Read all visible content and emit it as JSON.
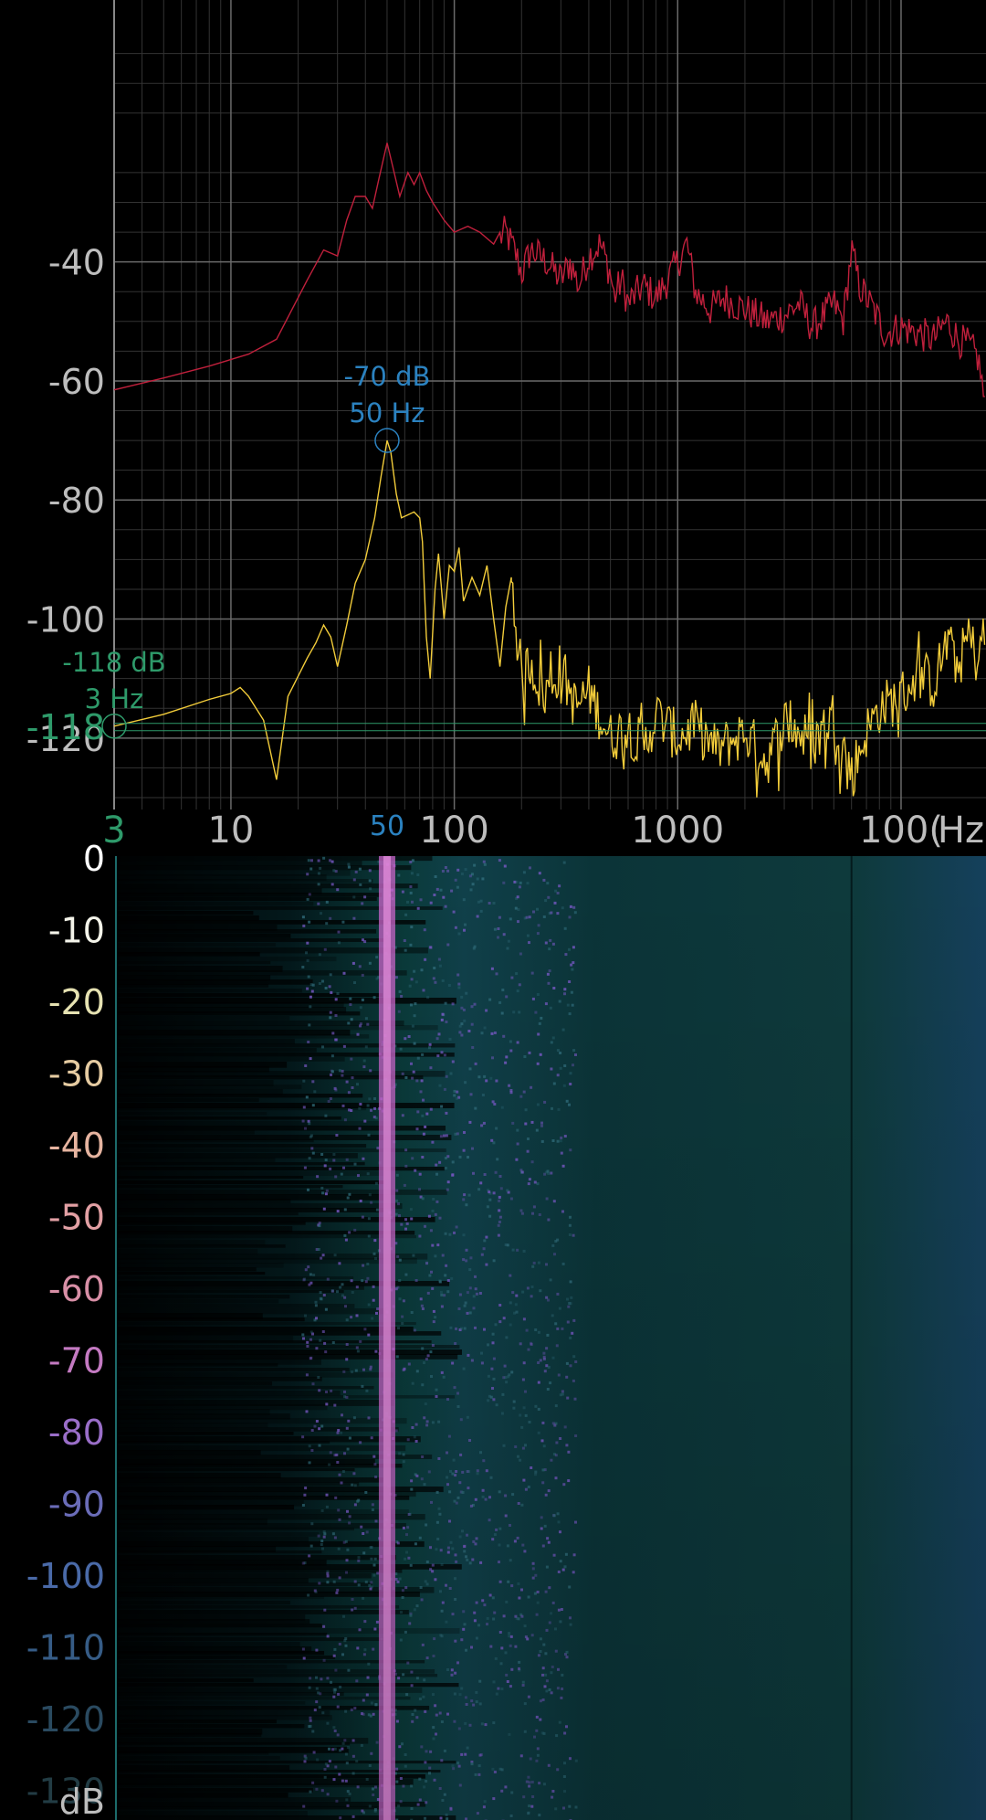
{
  "app": {
    "colors": {
      "background": "#000000",
      "grid_major": "#6a6a6a",
      "grid_minor": "#333333",
      "peak_hold_line": "#c0203c",
      "live_spectrum_line": "#f2cc3a",
      "peak_marker": "#2b82c0",
      "cursor_marker": "#2e9a6a",
      "axis_text": "#bdbdbd",
      "spectrogram_base": "#062a2e",
      "spectrogram_hot": "#cc66cc"
    }
  },
  "chart_data": [
    {
      "type": "line",
      "x_scale": "log",
      "xlim": [
        3,
        24000
      ],
      "ylim": [
        -132,
        4
      ],
      "grid": true,
      "x_unit": "Hz",
      "y_ticks": [
        -40,
        -60,
        -80,
        -100,
        -120
      ],
      "x_ticks": [
        10,
        100,
        1000,
        10000
      ],
      "x_tick_labels": [
        "10",
        "100",
        "1000",
        "100("
      ],
      "series": [
        {
          "color": "#c0203c",
          "points": [
            [
              3,
              -61.5
            ],
            [
              5,
              -59.5
            ],
            [
              8,
              -57.5
            ],
            [
              12,
              -55.5
            ],
            [
              16,
              -53
            ],
            [
              22,
              -43
            ],
            [
              26,
              -38
            ],
            [
              30,
              -39
            ],
            [
              33,
              -33
            ],
            [
              36,
              -29
            ],
            [
              40,
              -29
            ],
            [
              43,
              -31
            ],
            [
              46,
              -26
            ],
            [
              50,
              -20
            ],
            [
              53,
              -24
            ],
            [
              57,
              -29
            ],
            [
              62,
              -25
            ],
            [
              66,
              -27
            ],
            [
              70,
              -25
            ],
            [
              75,
              -28
            ],
            [
              80,
              -30
            ],
            [
              90,
              -33
            ],
            [
              100,
              -35
            ],
            [
              115,
              -34
            ],
            [
              130,
              -35
            ],
            [
              150,
              -37
            ],
            [
              170,
              -35
            ],
            [
              190,
              -39
            ],
            [
              200,
              -42
            ],
            [
              220,
              -38
            ],
            [
              260,
              -40
            ],
            [
              300,
              -43
            ],
            [
              330,
              -40
            ],
            [
              360,
              -44
            ],
            [
              400,
              -39
            ],
            [
              450,
              -37
            ],
            [
              500,
              -42
            ],
            [
              520,
              -46
            ],
            [
              560,
              -43
            ],
            [
              600,
              -47
            ],
            [
              700,
              -44
            ],
            [
              800,
              -46
            ],
            [
              900,
              -43
            ],
            [
              1000,
              -40
            ],
            [
              1100,
              -37
            ],
            [
              1200,
              -45
            ],
            [
              1400,
              -48
            ],
            [
              1600,
              -46
            ],
            [
              2000,
              -48
            ],
            [
              2500,
              -50
            ],
            [
              3000,
              -49
            ],
            [
              3500,
              -47
            ],
            [
              4000,
              -51
            ],
            [
              4500,
              -49
            ],
            [
              5000,
              -47
            ],
            [
              5500,
              -50
            ],
            [
              6000,
              -38
            ],
            [
              6500,
              -44
            ],
            [
              7500,
              -48
            ],
            [
              8500,
              -52
            ],
            [
              10000,
              -51
            ],
            [
              12000,
              -52
            ],
            [
              14000,
              -53
            ],
            [
              16000,
              -50
            ],
            [
              18000,
              -53
            ],
            [
              20000,
              -54
            ],
            [
              22000,
              -56
            ],
            [
              23000,
              -60
            ],
            [
              24000,
              -67
            ]
          ]
        },
        {
          "color": "#f2cc3a",
          "points": [
            [
              3,
              -118
            ],
            [
              5,
              -116
            ],
            [
              8,
              -113.5
            ],
            [
              10,
              -112.5
            ],
            [
              11,
              -111.5
            ],
            [
              12,
              -113
            ],
            [
              14,
              -117
            ],
            [
              16,
              -127
            ],
            [
              18,
              -113
            ],
            [
              22,
              -106.5
            ],
            [
              24,
              -104
            ],
            [
              26,
              -101
            ],
            [
              28,
              -103
            ],
            [
              30,
              -108
            ],
            [
              33,
              -101
            ],
            [
              36,
              -94
            ],
            [
              40,
              -90
            ],
            [
              44,
              -83
            ],
            [
              47,
              -76
            ],
            [
              50,
              -70
            ],
            [
              52,
              -72
            ],
            [
              55,
              -79
            ],
            [
              58,
              -83
            ],
            [
              62,
              -82.5
            ],
            [
              66,
              -82
            ],
            [
              70,
              -83
            ],
            [
              72,
              -87
            ],
            [
              75,
              -103
            ],
            [
              78,
              -110
            ],
            [
              82,
              -95
            ],
            [
              85,
              -89
            ],
            [
              90,
              -100
            ],
            [
              95,
              -91
            ],
            [
              100,
              -92
            ],
            [
              105,
              -88
            ],
            [
              110,
              -97
            ],
            [
              120,
              -93
            ],
            [
              130,
              -96
            ],
            [
              140,
              -91
            ],
            [
              150,
              -100
            ],
            [
              160,
              -108
            ],
            [
              170,
              -98
            ],
            [
              180,
              -93
            ],
            [
              190,
              -102
            ],
            [
              200,
              -110
            ],
            [
              220,
              -107
            ],
            [
              250,
              -113
            ],
            [
              300,
              -108
            ],
            [
              350,
              -115
            ],
            [
              400,
              -112
            ],
            [
              500,
              -120
            ],
            [
              600,
              -118
            ],
            [
              700,
              -122
            ],
            [
              800,
              -116
            ],
            [
              1000,
              -120
            ],
            [
              1200,
              -118
            ],
            [
              1500,
              -122
            ],
            [
              2000,
              -119
            ],
            [
              2500,
              -124
            ],
            [
              3000,
              -117
            ],
            [
              4000,
              -121
            ],
            [
              5000,
              -116
            ],
            [
              6000,
              -126
            ],
            [
              7000,
              -119
            ],
            [
              8000,
              -115
            ],
            [
              10000,
              -113
            ],
            [
              12000,
              -109
            ],
            [
              14000,
              -111
            ],
            [
              16000,
              -104
            ],
            [
              18000,
              -108
            ],
            [
              20000,
              -103
            ],
            [
              22000,
              -107
            ],
            [
              24000,
              -101
            ]
          ]
        }
      ],
      "annotations": [
        {
          "x": 50,
          "y": -70,
          "line1": "-70 dB",
          "line2": "50 Hz",
          "color": "#2b82c0"
        },
        {
          "x": 3,
          "y": -118,
          "line1": "-118 dB",
          "line2": "3 Hz",
          "color": "#2e9a6a"
        }
      ],
      "highlighted_x_tick": "50",
      "cursor_x_tick": "3",
      "cursor_y_tick": "-118",
      "x_unit_label": "Hz"
    },
    {
      "type": "heatmap",
      "xlim": [
        3,
        24000
      ],
      "y_ticks": [
        "0",
        "-10",
        "-20",
        "-30",
        "-40",
        "-50",
        "-60",
        "-70",
        "-80",
        "-90",
        "-100",
        "-110",
        "-120",
        "-130"
      ],
      "y_tick_colors": [
        "#ffffff",
        "#f4f4ea",
        "#e6e2b2",
        "#e6cca2",
        "#e6b4a0",
        "#e2a0a4",
        "#d88fa6",
        "#c47ac2",
        "#9a6ec8",
        "#6a6cb8",
        "#4a6aa8",
        "#365c86",
        "#2a4a60",
        "#223c44"
      ],
      "y_unit": "dB",
      "emphasis_line_x": 50
    }
  ]
}
